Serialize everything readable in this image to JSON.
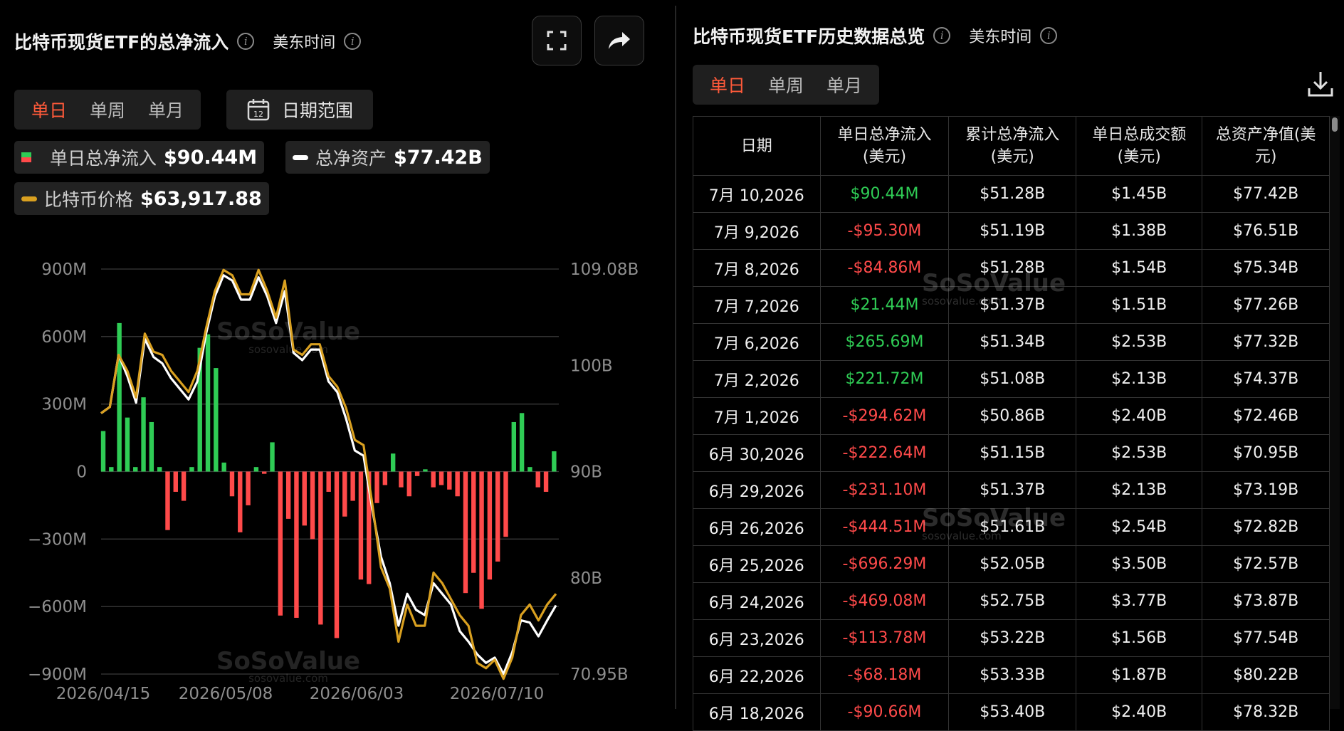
{
  "left_panel": {
    "title": "比特币现货ETF的总净流入",
    "timezone": "美东时间",
    "tabs": [
      "单日",
      "单周",
      "单月"
    ],
    "active_tab": "单日",
    "date_range_label": "日期范围",
    "calendar_day": "12",
    "legend": {
      "flow_label": "单日总净流入",
      "flow_value": "$90.44M",
      "assets_label": "总净资产",
      "assets_value": "$77.42B",
      "price_label": "比特币价格",
      "price_value": "$63,917.88"
    },
    "watermark": {
      "brand": "SoSoValue",
      "url": "sosovalue.com"
    }
  },
  "right_panel": {
    "title": "比特币现货ETF历史数据总览",
    "timezone": "美东时间",
    "tabs": [
      "单日",
      "单周",
      "单月"
    ],
    "active_tab": "单日",
    "headers": [
      "日期",
      "单日总净流入\n(美元)",
      "累计总净流入\n(美元)",
      "单日总成交额\n(美元)",
      "总资产净值(美\n元)"
    ],
    "rows": [
      [
        "7月 10,2026",
        "$90.44M",
        "$51.28B",
        "$1.45B",
        "$77.42B"
      ],
      [
        "7月 9,2026",
        "-$95.30M",
        "$51.19B",
        "$1.38B",
        "$76.51B"
      ],
      [
        "7月 8,2026",
        "-$84.86M",
        "$51.28B",
        "$1.54B",
        "$75.34B"
      ],
      [
        "7月 7,2026",
        "$21.44M",
        "$51.37B",
        "$1.51B",
        "$77.26B"
      ],
      [
        "7月 6,2026",
        "$265.69M",
        "$51.34B",
        "$2.53B",
        "$77.32B"
      ],
      [
        "7月 2,2026",
        "$221.72M",
        "$51.08B",
        "$2.13B",
        "$74.37B"
      ],
      [
        "7月 1,2026",
        "-$294.62M",
        "$50.86B",
        "$2.40B",
        "$72.46B"
      ],
      [
        "6月 30,2026",
        "-$222.64M",
        "$51.15B",
        "$2.53B",
        "$70.95B"
      ],
      [
        "6月 29,2026",
        "-$231.10M",
        "$51.37B",
        "$2.13B",
        "$73.19B"
      ],
      [
        "6月 26,2026",
        "-$444.51M",
        "$51.61B",
        "$2.54B",
        "$72.82B"
      ],
      [
        "6月 25,2026",
        "-$696.29M",
        "$52.05B",
        "$3.50B",
        "$72.57B"
      ],
      [
        "6月 24,2026",
        "-$469.08M",
        "$52.75B",
        "$3.77B",
        "$73.87B"
      ],
      [
        "6月 23,2026",
        "-$113.78M",
        "$53.22B",
        "$1.56B",
        "$77.54B"
      ],
      [
        "6月 22,2026",
        "-$68.18M",
        "$53.33B",
        "$1.87B",
        "$80.22B"
      ],
      [
        "6月 18,2026",
        "-$90.66M",
        "$53.40B",
        "$2.40B",
        "$78.32B"
      ]
    ],
    "watermark": {
      "brand": "SoSoValue",
      "url": "sosovalue.com"
    }
  },
  "colors": {
    "positive": "#2fcc55",
    "negative": "#ff4a4a",
    "assets_line": "#ffffff",
    "price_line": "#d9a020",
    "active_tab": "#ff5a3a"
  },
  "chart_data": {
    "type": "bar",
    "x_tick_labels": [
      "2026/04/15",
      "2026/05/08",
      "2026/06/03",
      "2026/07/10"
    ],
    "y_left_ticks": [
      "900M",
      "600M",
      "300M",
      "0",
      "−300M",
      "−600M",
      "−900M"
    ],
    "y_left_values": [
      900,
      600,
      300,
      0,
      -300,
      -600,
      -900
    ],
    "y_right_ticks": [
      "109.08B",
      "100B",
      "90B",
      "80B",
      "70.95B"
    ],
    "y_right_values": [
      109.08,
      100,
      90,
      80,
      70.95
    ],
    "ylim_left": [
      -900,
      900
    ],
    "ylim_right": [
      70.95,
      109.08
    ],
    "grid": true,
    "series": [
      {
        "name": "单日总净流入",
        "kind": "bar",
        "unit": "M USD",
        "values": [
          180,
          20,
          660,
          240,
          20,
          330,
          220,
          20,
          -260,
          -90,
          -130,
          20,
          550,
          610,
          460,
          40,
          -110,
          -270,
          -150,
          20,
          -10,
          130,
          -640,
          -210,
          -650,
          -240,
          -300,
          -680,
          -90,
          -740,
          -200,
          -130,
          -480,
          -500,
          -140,
          -60,
          80,
          -70,
          -110,
          -20,
          10,
          -70,
          -60,
          -80,
          -110,
          -540,
          -450,
          -610,
          -480,
          -400,
          -290,
          220,
          260,
          20,
          -70,
          -90,
          90
        ]
      },
      {
        "name": "总净资产",
        "kind": "line",
        "unit": "B USD",
        "values": [
          95.5,
          96.1,
          101,
          99,
          96.5,
          102.5,
          100.8,
          100.2,
          98.8,
          97.8,
          96.8,
          98.5,
          103,
          106.5,
          108.5,
          108,
          106.2,
          106.2,
          108.3,
          106.5,
          104,
          107,
          101.2,
          100.5,
          101.5,
          101.5,
          98.5,
          97.5,
          95,
          92,
          91.5,
          86.5,
          82,
          79.5,
          75.5,
          78.5,
          77,
          76.5,
          79.5,
          78.5,
          77.5,
          75,
          74,
          72.8,
          72,
          72.5,
          70.95,
          73,
          76,
          75.8,
          74.5,
          76,
          77.42
        ]
      },
      {
        "name": "比特币价格",
        "kind": "line",
        "values": [
          95.5,
          96.1,
          101,
          99.5,
          97,
          103,
          101.3,
          101,
          99.5,
          98.5,
          97.5,
          99.5,
          103.5,
          107,
          109,
          108.5,
          106.7,
          106.7,
          109,
          107,
          104.5,
          108,
          101.5,
          101,
          102,
          102,
          99,
          98,
          96,
          93,
          92.5,
          87,
          81,
          79,
          74,
          77.5,
          75.5,
          75.5,
          80.5,
          79.5,
          78,
          76.5,
          75.5,
          72,
          71.5,
          72.3,
          70.5,
          72.5,
          76.5,
          77.5,
          76,
          77.5,
          78.5
        ]
      }
    ]
  }
}
